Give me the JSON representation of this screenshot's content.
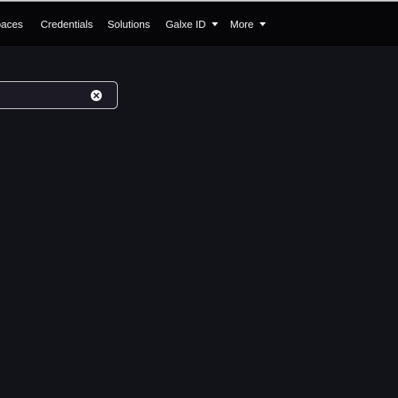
{
  "nav": {
    "items": [
      {
        "label": "paces"
      },
      {
        "label": "Credentials"
      },
      {
        "label": "Solutions"
      },
      {
        "label": "Galxe ID",
        "has_dropdown": true
      },
      {
        "label": "More",
        "has_dropdown": true
      }
    ]
  },
  "search": {
    "value": "",
    "clear_icon": "close-circle-icon"
  },
  "colors": {
    "navbar_background": "#060609",
    "page_background": "#121219",
    "text": "#f2f2f5",
    "search_border": "#d6d6dc"
  }
}
